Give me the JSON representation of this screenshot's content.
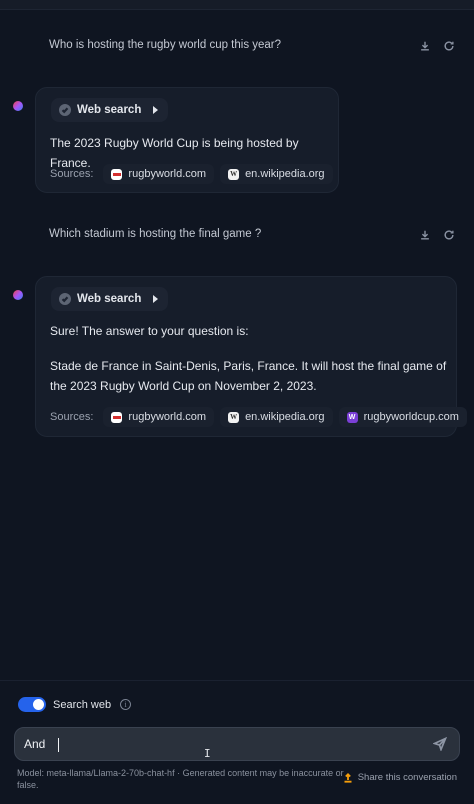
{
  "conversation": [
    {
      "question": "Who is hosting the rugby world cup this year?",
      "tool_label": "Web search",
      "answer_lines": [
        "The 2023 Rugby World Cup is being hosted by France."
      ],
      "sources_label": "Sources:",
      "sources": [
        {
          "favicon": "rugbyworld-favicon",
          "label": "rugbyworld.com"
        },
        {
          "favicon": "wikipedia-favicon",
          "label": "en.wikipedia.org"
        }
      ]
    },
    {
      "question": "Which stadium is hosting the final game ?",
      "tool_label": "Web search",
      "answer_lines": [
        "Sure! The answer to your question is:",
        "Stade de France in Saint-Denis, Paris, France. It will host the final game of",
        "the 2023 Rugby World Cup on November 2, 2023."
      ],
      "sources_label": "Sources:",
      "sources": [
        {
          "favicon": "rugbyworld-favicon",
          "label": "rugbyworld.com"
        },
        {
          "favicon": "wikipedia-favicon",
          "label": "en.wikipedia.org"
        },
        {
          "favicon": "rugbyworldcup-favicon",
          "label": "rugbyworldcup.com"
        }
      ]
    }
  ],
  "composer": {
    "search_web_label": "Search web",
    "search_web_enabled": true,
    "input_value": "And",
    "send_icon": "send-icon"
  },
  "footer": {
    "model_note": "Model: meta-llama/Llama-2-70b-chat-hf · Generated content may be inaccurate or false.",
    "share_label": "Share this conversation"
  },
  "colors": {
    "background": "#0f1521",
    "card": "#161d2a",
    "accent": "#2563eb",
    "share_icon": "#f59e0b"
  }
}
